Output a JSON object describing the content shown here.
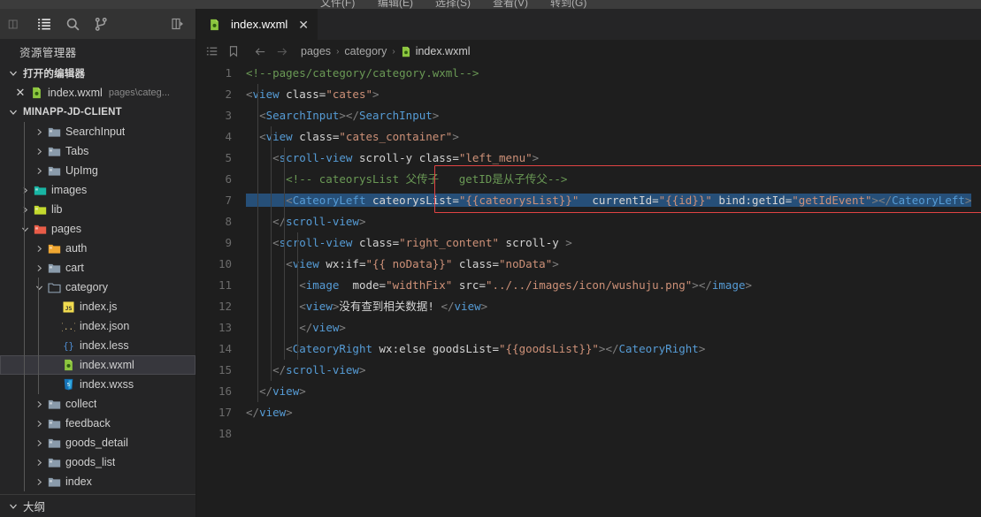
{
  "menubar": {
    "items": [
      "文件(F)",
      "编辑(E)",
      "选择(S)",
      "查看(V)",
      "转到(G)"
    ]
  },
  "activitybar": {
    "icons": [
      {
        "name": "explorer-icon",
        "active": true
      },
      {
        "name": "search-icon",
        "active": false
      },
      {
        "name": "source-control-icon",
        "active": false
      }
    ],
    "collapse_label": "collapse-sidebar-icon"
  },
  "sidebar": {
    "title": "资源管理器",
    "open_editors": {
      "label": "打开的编辑器",
      "items": [
        {
          "name": "index.wxml",
          "detail": "pages\\categ...",
          "icon": "wxml-file-icon"
        }
      ]
    },
    "project": {
      "label": "MINAPP-JD-CLIENT",
      "tree": [
        {
          "label": "SearchInput",
          "depth": 2,
          "kind": "folder",
          "color": "#8a9bab",
          "twisty": "right"
        },
        {
          "label": "Tabs",
          "depth": 2,
          "kind": "folder",
          "color": "#8a9bab",
          "twisty": "right"
        },
        {
          "label": "UpImg",
          "depth": 2,
          "kind": "folder",
          "color": "#8a9bab",
          "twisty": "right"
        },
        {
          "label": "images",
          "depth": 1,
          "kind": "folder",
          "color": "#19b5a4",
          "twisty": "right"
        },
        {
          "label": "lib",
          "depth": 1,
          "kind": "folder",
          "color": "#c3d92e",
          "twisty": "right"
        },
        {
          "label": "pages",
          "depth": 1,
          "kind": "folder",
          "color": "#e85c48",
          "twisty": "down"
        },
        {
          "label": "auth",
          "depth": 2,
          "kind": "folder",
          "color": "#f0a732",
          "twisty": "right"
        },
        {
          "label": "cart",
          "depth": 2,
          "kind": "folder",
          "color": "#8a9bab",
          "twisty": "right"
        },
        {
          "label": "category",
          "depth": 2,
          "kind": "folder-open",
          "color": "#8a9bab",
          "twisty": "down"
        },
        {
          "label": "index.js",
          "depth": 3,
          "kind": "file",
          "icon": "js-file-icon"
        },
        {
          "label": "index.json",
          "depth": 3,
          "kind": "file",
          "icon": "json-file-icon"
        },
        {
          "label": "index.less",
          "depth": 3,
          "kind": "file",
          "icon": "less-file-icon"
        },
        {
          "label": "index.wxml",
          "depth": 3,
          "kind": "file",
          "icon": "wxml-file-icon",
          "selected": true
        },
        {
          "label": "index.wxss",
          "depth": 3,
          "kind": "file",
          "icon": "wxss-file-icon"
        },
        {
          "label": "collect",
          "depth": 2,
          "kind": "folder",
          "color": "#8a9bab",
          "twisty": "right"
        },
        {
          "label": "feedback",
          "depth": 2,
          "kind": "folder",
          "color": "#8a9bab",
          "twisty": "right"
        },
        {
          "label": "goods_detail",
          "depth": 2,
          "kind": "folder",
          "color": "#8a9bab",
          "twisty": "right"
        },
        {
          "label": "goods_list",
          "depth": 2,
          "kind": "folder",
          "color": "#8a9bab",
          "twisty": "right"
        },
        {
          "label": "index",
          "depth": 2,
          "kind": "folder",
          "color": "#8a9bab",
          "twisty": "right"
        }
      ]
    },
    "outline": {
      "label": "大纲"
    }
  },
  "editor": {
    "tab": {
      "label": "index.wxml",
      "icon": "wxml-file-icon",
      "close": "✕"
    },
    "breadcrumb": {
      "outline_icon": "outline-icon",
      "bookmark_icon": "bookmark-icon",
      "back_icon": "arrow-left-icon",
      "forward_icon": "arrow-right-icon",
      "separator": "›",
      "path": [
        "pages",
        "category",
        "index.wxml"
      ]
    },
    "line_numbers": [
      1,
      2,
      3,
      4,
      5,
      6,
      7,
      8,
      9,
      10,
      11,
      12,
      13,
      14,
      15,
      16,
      17,
      18
    ],
    "code_lines": [
      "<!--pages/category/category.wxml-->",
      "<view class=\"cates\">",
      "  <SearchInput></SearchInput>",
      "  <view class=\"cates_container\">",
      "    <scroll-view scroll-y class=\"left_menu\">",
      "      <!-- cateorysList 父传子   getID是从子传父-->",
      "      <CateoryLeft cateorysList=\"{{cateorysList}}\"  currentId=\"{{id}}\" bind:getId=\"getIdEvent\"></CateoryLeft>",
      "    </scroll-view>",
      "    <scroll-view class=\"right_content\" scroll-y >",
      "      <view wx:if=\"{{ noData}}\" class=\"noData\">",
      "        <image  mode=\"widthFix\" src=\"../../images/icon/wushuju.png\"></image>",
      "        <view>没有查到相关数据! </view>",
      "        </view>",
      "      <CateoryRight wx:else goodsList=\"{{goodsList}}\"></CateoryRight>",
      "    </scroll-view>",
      "  </view>",
      "</view>",
      ""
    ],
    "annotation": {
      "name": "red-highlight-box",
      "color": "#e04343",
      "lines": [
        6,
        7
      ]
    },
    "selection": {
      "line": 7,
      "color": "#264f78"
    }
  },
  "colors": {
    "editor_bg": "#1e1e1e",
    "sidebar_bg": "#252526",
    "activitybar_bg": "#333333",
    "comment": "#6a9955",
    "tag": "#569cd6",
    "attribute": "#9cdcfe",
    "string": "#ce9178",
    "accent_red": "#e04343"
  }
}
